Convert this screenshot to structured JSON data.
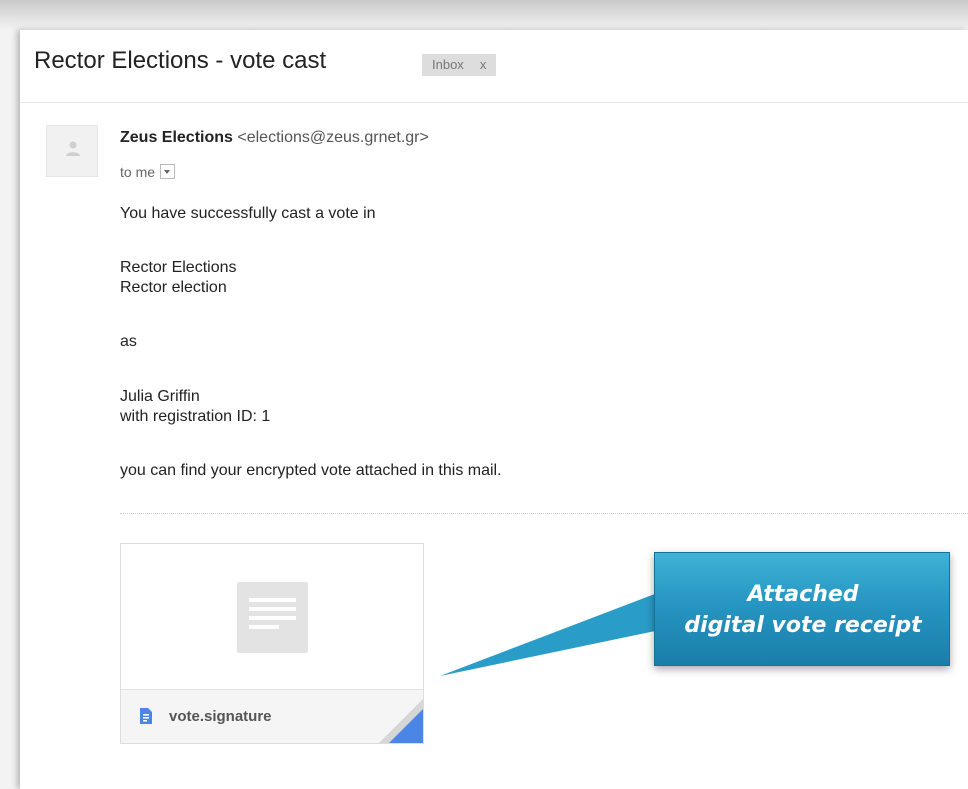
{
  "email": {
    "subject": "Rector Elections - vote cast",
    "label": "Inbox",
    "label_close": "x",
    "sender_name": "Zeus Elections",
    "sender_email": "<elections@zeus.grnet.gr>",
    "recipient": "to me",
    "body": {
      "line1": "You have successfully cast a vote in",
      "line2": "Rector Elections",
      "line3": "Rector election",
      "line4": "as",
      "line5": "Julia Griffin",
      "line6": "with registration ID: 1",
      "line7": "you can find your encrypted vote attached in this mail."
    },
    "attachment": {
      "filename": "vote.signature"
    }
  },
  "callout": {
    "line1": "Attached",
    "line2": "digital vote receipt"
  },
  "colors": {
    "callout": "#2696c2",
    "attachment_corner": "#4a86e8",
    "file_icon": "#4a86e8"
  },
  "icons": {
    "avatar": "person-silhouette-icon",
    "dropdown": "chevron-down-icon",
    "preview": "document-icon",
    "file": "file-icon"
  }
}
